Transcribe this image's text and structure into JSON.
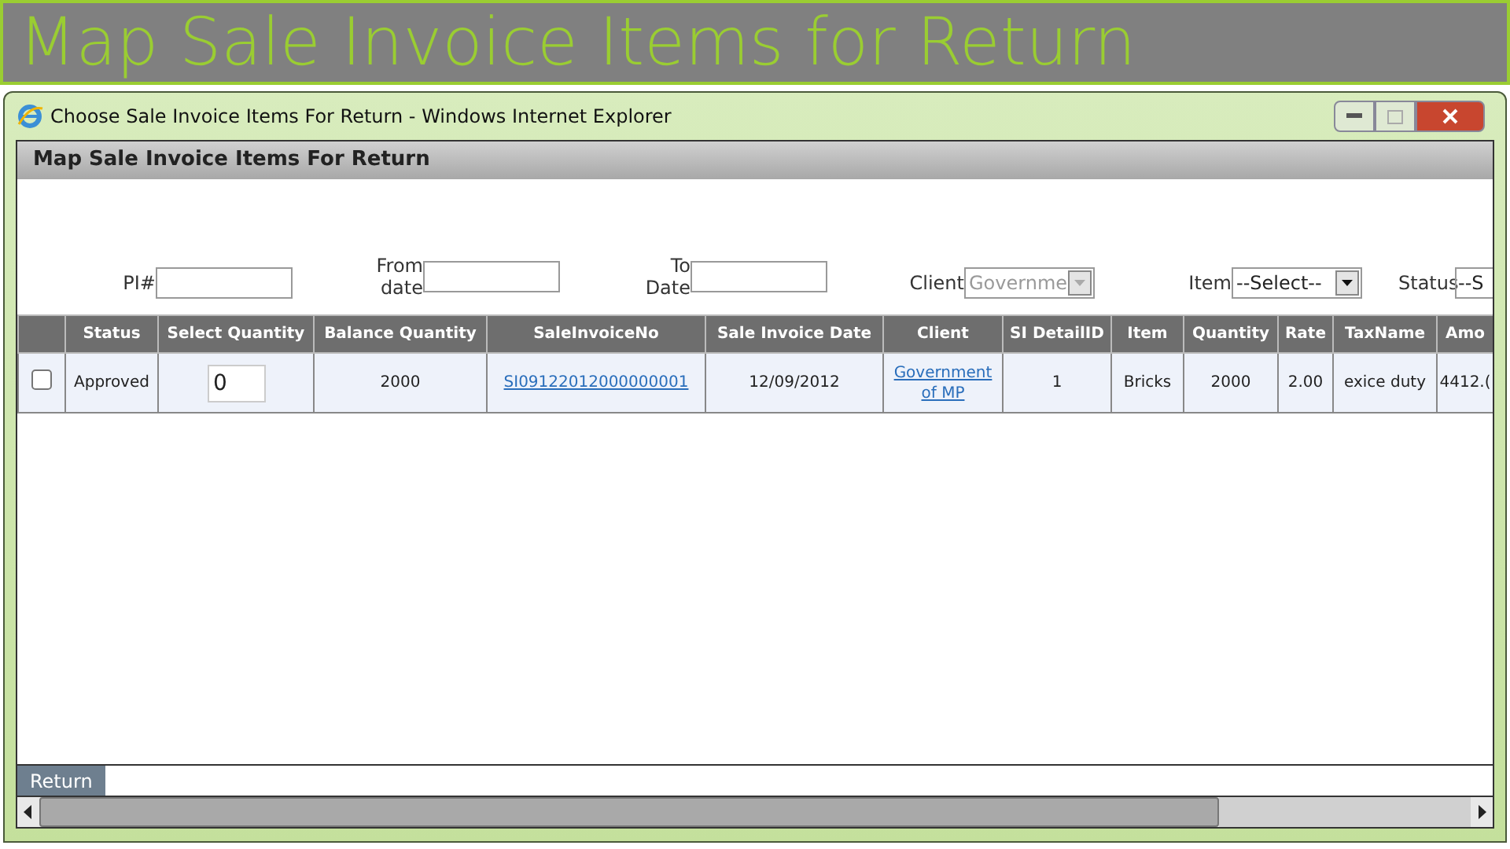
{
  "slide_title": "Map Sale Invoice Items for Return",
  "window": {
    "title": "Choose Sale Invoice Items For Return - Windows Internet Explorer"
  },
  "panel_title": "Map Sale Invoice Items For Return",
  "filters": [
    {
      "kind": "text",
      "label": "PI#"
    },
    {
      "kind": "text",
      "label": "From date"
    },
    {
      "kind": "text",
      "label": "To Date"
    },
    {
      "kind": "select",
      "label": "Client",
      "value": "Governme",
      "disabled": true
    },
    {
      "kind": "select",
      "label": "Item",
      "value": "--Select--",
      "disabled": false
    },
    {
      "kind": "cut",
      "label": "Status",
      "value": "--S"
    }
  ],
  "table": {
    "columns": [
      "Status",
      "Select Quantity",
      "Balance Quantity",
      "SaleInvoiceNo",
      "Sale Invoice Date",
      "Client",
      "SI DetailID",
      "Item",
      "Quantity",
      "Rate",
      "TaxName",
      "Amo"
    ],
    "rows": [
      {
        "checked": false,
        "cells": [
          {
            "kind": "text",
            "text": "Approved"
          },
          {
            "kind": "input",
            "text": "0"
          },
          {
            "kind": "text",
            "text": "2000"
          },
          {
            "kind": "link",
            "text": "SI09122012000000001"
          },
          {
            "kind": "text",
            "text": "12/09/2012"
          },
          {
            "kind": "link",
            "text": "Government of MP"
          },
          {
            "kind": "text",
            "text": "1"
          },
          {
            "kind": "text",
            "text": "Bricks"
          },
          {
            "kind": "text",
            "text": "2000"
          },
          {
            "kind": "text",
            "text": "2.00"
          },
          {
            "kind": "text",
            "text": "exice duty"
          },
          {
            "kind": "text",
            "text": "4412.("
          }
        ]
      }
    ]
  },
  "buttons": [
    "Return"
  ]
}
